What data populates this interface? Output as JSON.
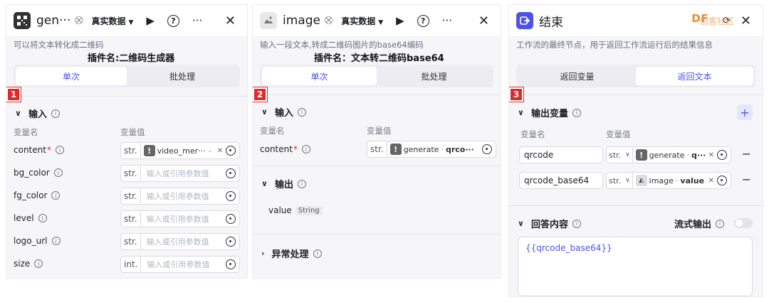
{
  "panel1": {
    "title": "gen···",
    "data_mode": "真实数据",
    "description": "可以将文本转化成二维码",
    "plugin_note": "插件名:二维码生成器",
    "badge": "1",
    "tabs": [
      {
        "label": "单次",
        "active": true
      },
      {
        "label": "批处理",
        "active": false
      }
    ],
    "section_input": "输入",
    "col_name": "变量名",
    "col_value": "变量值",
    "rows": [
      {
        "name": "content",
        "required": true,
        "type": "str.",
        "ref": "video_mer···",
        "ref_suffix": "-"
      },
      {
        "name": "bg_color",
        "type": "str.",
        "placeholder": "输入或引用参数值"
      },
      {
        "name": "fg_color",
        "type": "str.",
        "placeholder": "输入或引用参数值"
      },
      {
        "name": "level",
        "type": "str.",
        "placeholder": "输入或引用参数值"
      },
      {
        "name": "logo_url",
        "type": "str.",
        "placeholder": "输入或引用参数值"
      },
      {
        "name": "size",
        "type": "int.",
        "placeholder": "输入或引用参数值"
      }
    ]
  },
  "panel2": {
    "title": "image",
    "data_mode": "真实数据",
    "description": "输入一段文本,转成二维码图片的base64编码",
    "plugin_note": "插件名：文本转二维码base64",
    "badge": "2",
    "tabs": [
      {
        "label": "单次",
        "active": true
      },
      {
        "label": "批处理",
        "active": false
      }
    ],
    "section_input": "输入",
    "col_name": "变量名",
    "col_value": "变量值",
    "content_row": {
      "name": "content",
      "type": "str.",
      "ref_node": "generate",
      "ref_sep": "·",
      "ref_var": "qrco···"
    },
    "section_output": "输出",
    "output_var": {
      "name": "value",
      "type": "String"
    },
    "section_exception": "异常处理"
  },
  "panel3": {
    "title": "结束",
    "description": "工作流的最终节点，用于返回工作流运行后的结果信息",
    "badge": "3",
    "tabs": [
      {
        "label": "返回变量",
        "active": false
      },
      {
        "label": "返回文本",
        "active": true
      }
    ],
    "section_output": "输出变量",
    "col_name": "变量名",
    "col_value": "变量值",
    "rows": [
      {
        "name": "qrcode",
        "type": "str.",
        "ref_node": "generate",
        "ref_sep": "·",
        "ref_var": "q···"
      },
      {
        "name": "qrcode_base64",
        "type": "str.",
        "ref_node": "image",
        "ref_sep": "·",
        "ref_var": "value"
      }
    ],
    "section_answer": "回答内容",
    "stream_label": "流式输出",
    "answer_text": "{{qrcode_base64}}"
  },
  "watermark": {
    "logo": "DF",
    "sub": "创客社区"
  },
  "colors": {
    "accent": "#4d53e8",
    "badge": "#e02a2a",
    "panel_bg": "#f6f6f9"
  }
}
